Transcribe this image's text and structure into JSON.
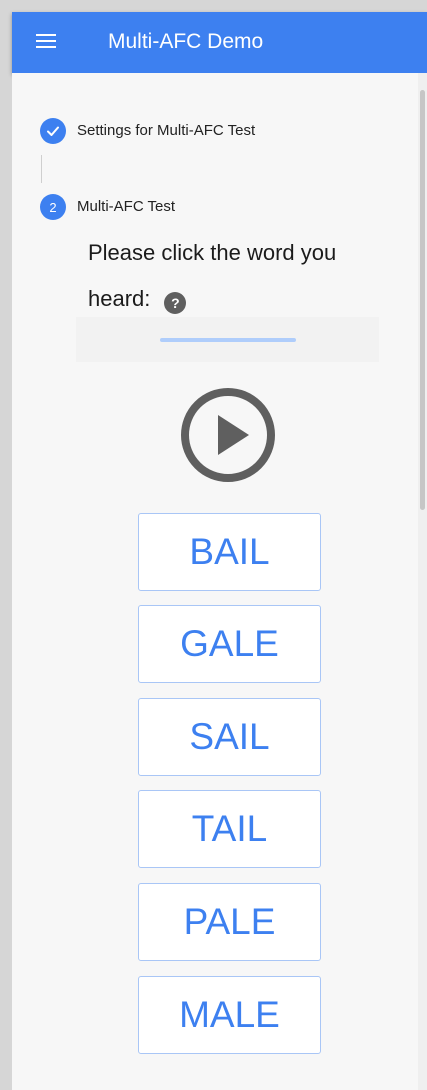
{
  "app": {
    "title": "Multi-AFC Demo",
    "menu_icon": "menu-icon"
  },
  "stepper": {
    "steps": [
      {
        "marker": "✓",
        "icon": "check-icon",
        "label": "Settings for Multi-AFC Test",
        "state": "complete"
      },
      {
        "marker": "2",
        "label": "Multi-AFC Test",
        "state": "active"
      }
    ]
  },
  "test": {
    "prompt": "Please click the word you heard:",
    "help_marker": "?",
    "help_icon": "help-icon",
    "play_icon": "play-icon",
    "progress_icon": "loading-indicator",
    "choices": [
      "BAIL",
      "GALE",
      "SAIL",
      "TAIL",
      "PALE",
      "MALE"
    ]
  },
  "colors": {
    "primary": "#3d80f0",
    "button_border": "#a9c6f6",
    "progress": "#afcdfb",
    "icon_dark": "#5f5f5f"
  }
}
